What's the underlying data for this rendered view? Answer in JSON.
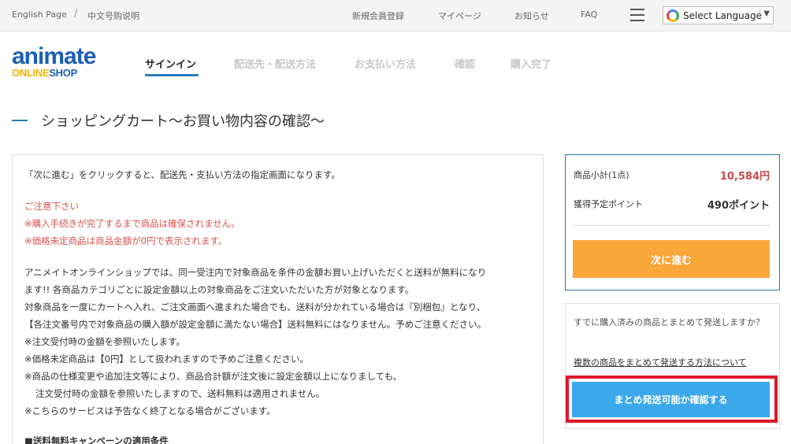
{
  "topbar": {
    "english_page": "English Page",
    "separator": "/",
    "chinese_guide": "中文号购说明",
    "register": "新規会員登録",
    "mypage": "マイページ",
    "news": "お知らせ",
    "faq": "FAQ",
    "language": "Select Language"
  },
  "logo": {
    "line1": "animate",
    "line2a": "ONLINE",
    "line2b": "SHOP"
  },
  "steps": [
    "サインイン",
    "配送先・配送方法",
    "お支払い方法",
    "確認",
    "購入完了"
  ],
  "page_title": "ショッピングカート〜お買い物内容の確認〜",
  "info": {
    "intro": "「次に進む」をクリックすると、配送先・支払い方法の指定画面になります。",
    "notice_title": "ご注意下さい",
    "notice_1": "※購入手続きが完了するまで商品は確保されません。",
    "notice_2": "※価格未定商品は商品金額が0円で表示されます。",
    "body_1": "アニメイトオンラインショップでは、同一受注内で対象商品を条件の金額お買い上げいただくと送料が無料になり",
    "body_2": "ます!! 各商品カテゴリごとに設定金額以上の対象商品をご注文いただいた方が対象となります。",
    "body_3": "対象商品を一度にカートへ入れ、ご注文画面へ進まれた場合でも、送料が分かれている場合は『別梱包』となり、",
    "body_4": "【各注文番号内で対象商品の購入額が設定金額に満たない場合】送料無料にはなりません。予めご注意ください。",
    "body_5": "※注文受付時の金額を参照いたします。",
    "body_6": "※価格未定商品は【0円】として扱われますので予めご注意ください。",
    "body_7": "※商品の仕様変更や追加注文等により、商品合計額が注文後に設定金額以上になりましても、",
    "body_8": "注文受付時の金額を参照いたしますので、送料無料は適用されません。",
    "body_9": "※こちらのサービスは予告なく終了となる場合がございます。",
    "section": "■送料無料キャンペーンの適用条件"
  },
  "summary": {
    "subtotal_label": "商品小計(1点)",
    "subtotal_value": "10,584円",
    "points_label": "獲得予定ポイント",
    "points_value": "490ポイント",
    "next_button": "次に進む"
  },
  "bundle": {
    "question": "すでに購入済みの商品とまとめて発送しますか？",
    "link": "複数の商品をまとめて発送する方法について",
    "confirm_button": "まとめ発送可能か確認する"
  },
  "colors": {
    "accent_blue": "#2a7ab8",
    "next_orange": "#f9a63a",
    "confirm_blue": "#3aa8ea",
    "highlight_red": "#e0162b",
    "price_red": "#c94a4a"
  }
}
